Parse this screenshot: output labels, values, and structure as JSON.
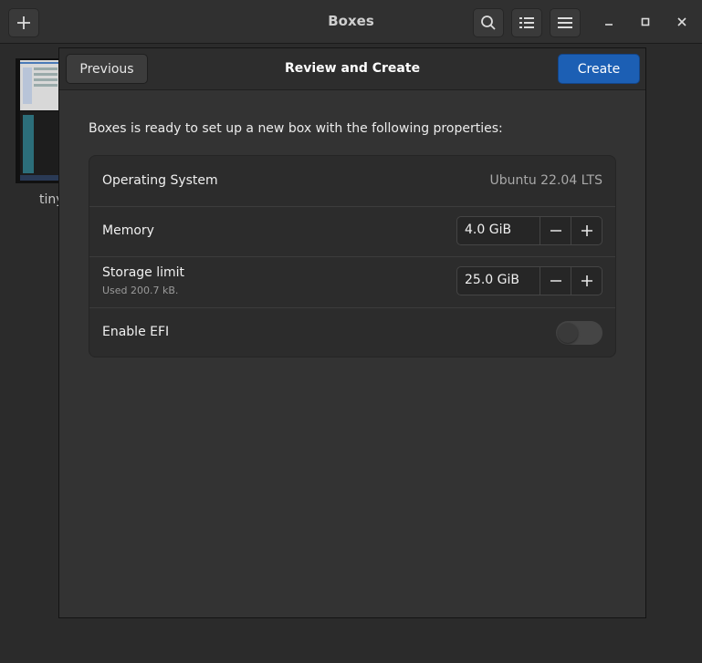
{
  "window": {
    "title": "Boxes",
    "thumbnail_label": "tiny"
  },
  "header_icons": {
    "add": "plus-icon",
    "search": "search-icon",
    "view": "list-view-icon",
    "menu": "hamburger-menu-icon",
    "minimize": "minimize-icon",
    "maximize": "maximize-icon",
    "close": "close-icon"
  },
  "dialog": {
    "title": "Review and Create",
    "previous_label": "Previous",
    "create_label": "Create",
    "intro": "Boxes is ready to set up a new box with the following properties:",
    "accent_color": "#1c5fb4"
  },
  "properties": {
    "os": {
      "label": "Operating System",
      "value": "Ubuntu 22.04 LTS"
    },
    "memory": {
      "label": "Memory",
      "value": "4.0 GiB"
    },
    "storage": {
      "label": "Storage limit",
      "sublabel": "Used 200.7 kB.",
      "value": "25.0 GiB"
    },
    "efi": {
      "label": "Enable EFI",
      "enabled": false
    }
  }
}
